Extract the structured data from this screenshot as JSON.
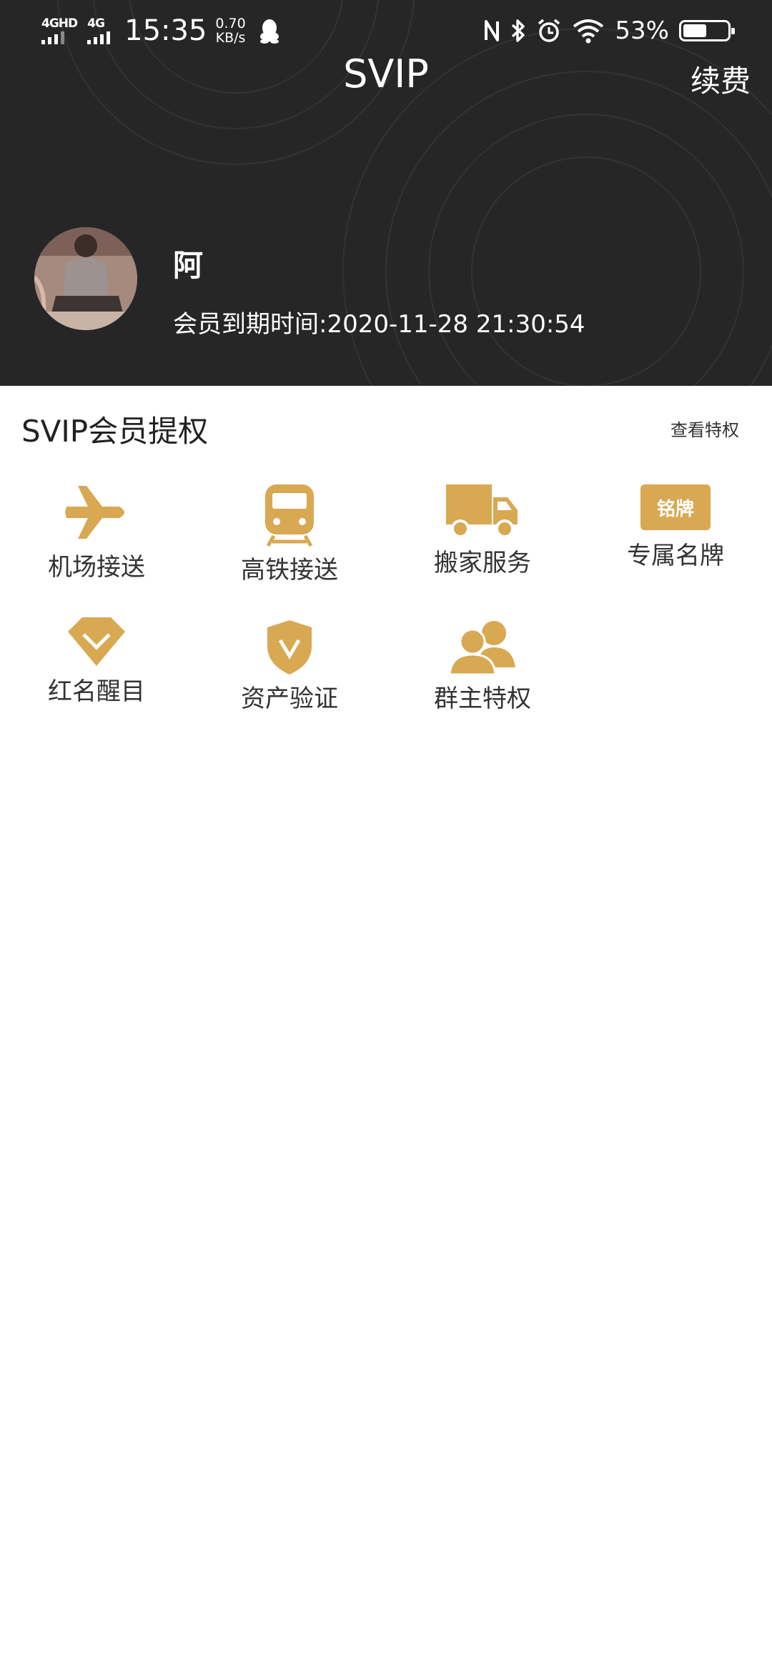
{
  "status_bar": {
    "signal1_label": "4GHD",
    "signal2_label": "4G",
    "time": "15:35",
    "net_speed_value": "0.70",
    "net_speed_unit": "KB/s",
    "battery_percent_text": "53%",
    "battery_level": 0.53,
    "icons": [
      "qq-icon",
      "nfc-icon",
      "bluetooth-icon",
      "alarm-icon",
      "wifi-icon",
      "battery-icon"
    ]
  },
  "header": {
    "title": "SVIP",
    "renew_label": "续费"
  },
  "profile": {
    "name": "阿",
    "expire_text": "会员到期时间:2020-11-28 21:30:54"
  },
  "privileges": {
    "title": "SVIP会员提权",
    "view_label": "查看特权",
    "accent_color": "#d8a852",
    "items": [
      {
        "label": "机场接送",
        "icon": "airplane-icon"
      },
      {
        "label": "高铁接送",
        "icon": "train-icon"
      },
      {
        "label": "搬家服务",
        "icon": "truck-icon"
      },
      {
        "label": "专属名牌",
        "icon": "nameplate-icon",
        "badge_text": "铭牌"
      },
      {
        "label": "红名醒目",
        "icon": "diamond-icon"
      },
      {
        "label": "资产验证",
        "icon": "shield-check-icon"
      },
      {
        "label": "群主特权",
        "icon": "group-icon"
      }
    ]
  }
}
